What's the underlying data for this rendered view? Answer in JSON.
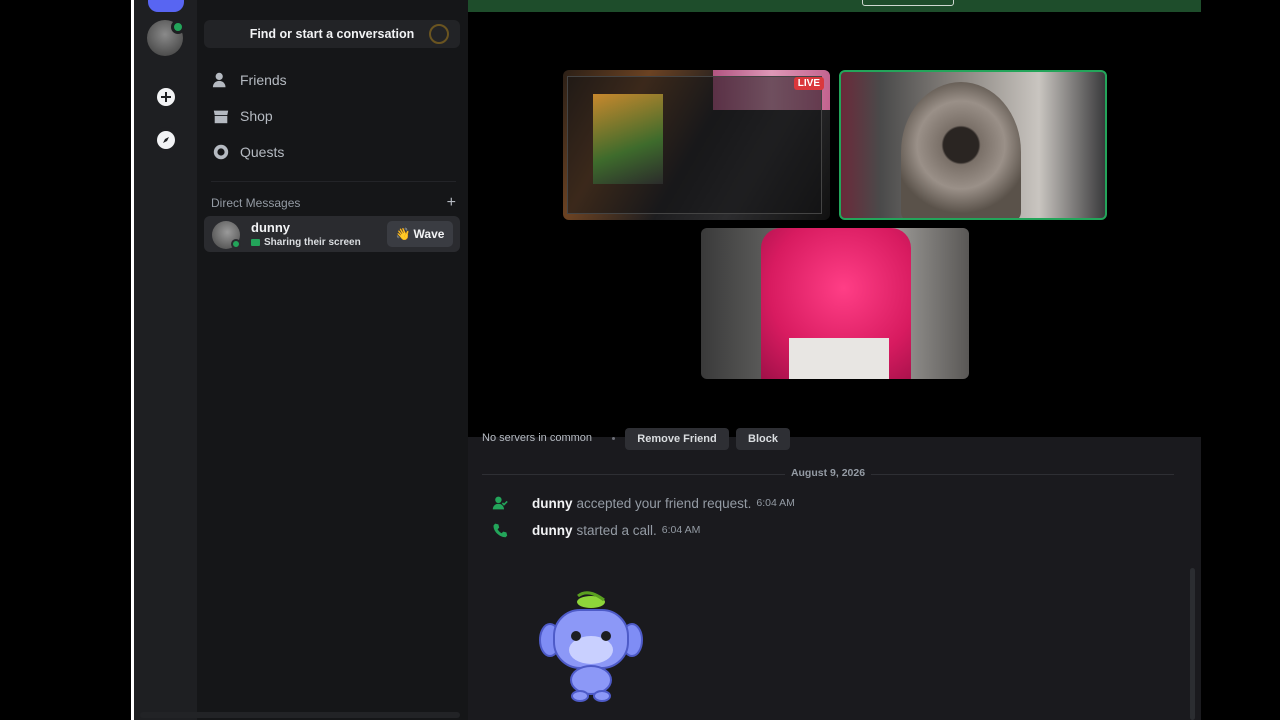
{
  "search": {
    "placeholder": "Find or start a conversation"
  },
  "nav": [
    {
      "label": "Friends",
      "icon": "friends-icon"
    },
    {
      "label": "Shop",
      "icon": "shop-icon"
    },
    {
      "label": "Quests",
      "icon": "quests-icon"
    }
  ],
  "dm": {
    "header": "Direct Messages",
    "add_icon": "plus-icon",
    "user": {
      "name": "dunny",
      "status": "Sharing their screen",
      "wave": "Wave",
      "wave_emoji": "👋"
    }
  },
  "call": {
    "live_badge": "LIVE"
  },
  "profile": {
    "no_servers": "No servers in common",
    "remove_friend": "Remove Friend",
    "block": "Block"
  },
  "chat": {
    "date": "August 9, 2026",
    "messages": [
      {
        "icon": "friend-accepted-icon",
        "user": "dunny",
        "text": "accepted your friend request.",
        "time": "6:04 AM"
      },
      {
        "icon": "phone-icon",
        "user": "dunny",
        "text": "started a call.",
        "time": "6:04 AM"
      }
    ]
  },
  "colors": {
    "accent": "#5865f2",
    "online": "#23a55a",
    "live": "#da373c"
  }
}
